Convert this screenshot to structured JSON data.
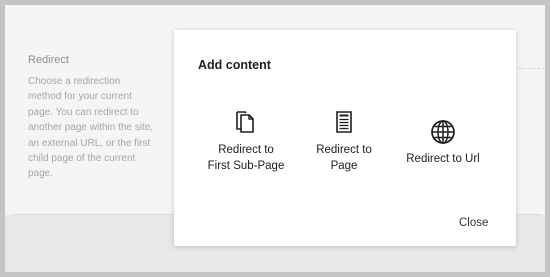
{
  "background_panel": {
    "title": "Redirect",
    "description": "Choose a redirection method for your current page. You can redirect to another page within the site, an external URL, or the first child page of the current page."
  },
  "modal": {
    "title": "Add content",
    "options": [
      {
        "label_line1": "Redirect to",
        "label_line2": "First Sub-Page",
        "icon": "documents-icon"
      },
      {
        "label_line1": "Redirect to",
        "label_line2": "Page",
        "icon": "page-icon"
      },
      {
        "label_line1": "Redirect to Url",
        "icon": "globe-icon"
      }
    ],
    "close_label": "Close"
  },
  "colors": {
    "modal_background": "#ffffff",
    "text": "#202020",
    "muted_text": "#a6a6a6",
    "frame": "#c4c4c4"
  }
}
